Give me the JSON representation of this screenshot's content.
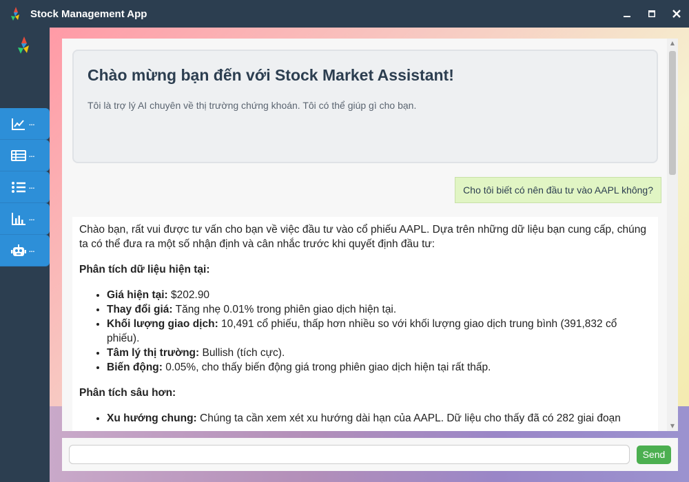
{
  "window": {
    "title": "Stock Management App",
    "minimize": "—",
    "maximize": "▬",
    "close": "✕"
  },
  "sidebar": {
    "items": [
      {
        "icon": "line-chart-icon",
        "label": "..."
      },
      {
        "icon": "table-icon",
        "label": "..."
      },
      {
        "icon": "list-icon",
        "label": "..."
      },
      {
        "icon": "bar-chart-icon",
        "label": "..."
      },
      {
        "icon": "robot-icon",
        "label": "..."
      }
    ]
  },
  "welcome": {
    "title": "Chào mừng bạn đến với Stock Market Assistant!",
    "subtitle": "Tôi là trợ lý AI chuyên về thị trường chứng khoán. Tôi có thể giúp gì cho bạn."
  },
  "user_message": "Cho tôi biết có nên đầu tư vào AAPL không?",
  "bot_message": {
    "intro": "Chào bạn, rất vui được tư vấn cho bạn về việc đầu tư vào cổ phiếu AAPL. Dựa trên những dữ liệu bạn cung cấp, chúng ta có thể đưa ra một số nhận định và cân nhắc trước khi quyết định đầu tư:",
    "section1_title": "Phân tích dữ liệu hiện tại:",
    "section1_items": [
      {
        "label": "Giá hiện tại:",
        "text": " $202.90"
      },
      {
        "label": "Thay đổi giá:",
        "text": " Tăng nhẹ 0.01% trong phiên giao dịch hiện tại."
      },
      {
        "label": "Khối lượng giao dịch:",
        "text": " 10,491 cổ phiếu, thấp hơn nhiều so với khối lượng giao dịch trung bình (391,832 cổ phiếu)."
      },
      {
        "label": "Tâm lý thị trường:",
        "text": " Bullish (tích cực)."
      },
      {
        "label": "Biến động:",
        "text": " 0.05%, cho thấy biến động giá trong phiên giao dịch hiện tại rất thấp."
      }
    ],
    "section2_title": "Phân tích sâu hơn:",
    "section2_items": [
      {
        "label": "Xu hướng chung:",
        "text": " Chúng ta cần xem xét xu hướng dài hạn của AAPL. Dữ liệu cho thấy đã có 282 giai đoạn"
      }
    ]
  },
  "input": {
    "placeholder": "",
    "value": "",
    "send_label": "Send"
  },
  "colors": {
    "sidebar_bg": "#2c3e50",
    "nav_item": "#2d8fd8",
    "send_button": "#4caf50",
    "user_bubble": "#e1f5c4"
  }
}
